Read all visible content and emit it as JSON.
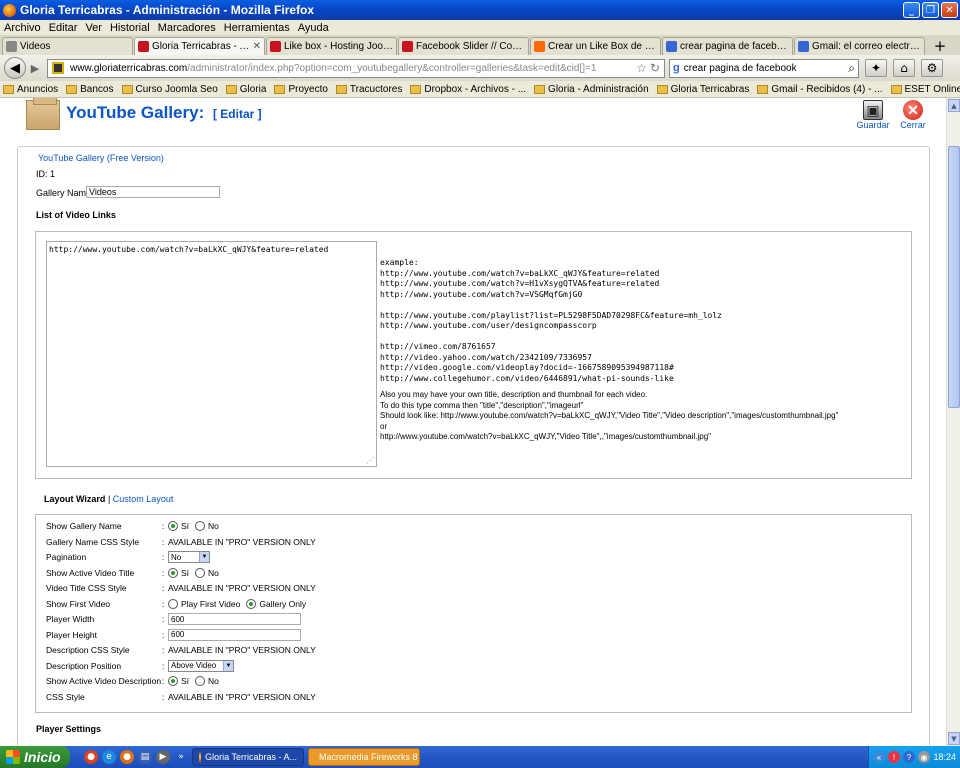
{
  "window": {
    "title": "Gloria Terricabras - Administración - Mozilla Firefox"
  },
  "menu": [
    "Archivo",
    "Editar",
    "Ver",
    "Historial",
    "Marcadores",
    "Herramientas",
    "Ayuda"
  ],
  "tabs": [
    {
      "label": "Videos",
      "icon_color": "#888888"
    },
    {
      "label": "Gloria Terricabras - Admin...",
      "icon_color": "#c8141e",
      "active": true
    },
    {
      "label": "Like box - Hosting Joomla",
      "icon_color": "#c8141e"
    },
    {
      "label": "Facebook Slider // Como c...",
      "icon_color": "#c8141e"
    },
    {
      "label": "Crear un Like Box de Fac...",
      "icon_color": "#ff6a00"
    },
    {
      "label": "crear pagina de facebook...",
      "icon_color": "#3666d6"
    },
    {
      "label": "Gmail: el correo electrónic...",
      "icon_color": "#3666d6"
    }
  ],
  "nav": {
    "url_domain": "www.gloriaterricabras.com",
    "url_path": "/administrator/index.php?option=com_youtubegallery&controller=galleries&task=edit&cid[]=1",
    "search_engine": "g",
    "search_value": "crear pagina de facebook"
  },
  "bookmarks": [
    "Anuncios",
    "Bancos",
    "Curso Joomla Seo",
    "Gloria",
    "Proyecto",
    "Tracuctores",
    "Dropbox - Archivos - ...",
    "Gloria - Administración",
    "Gloria Terricabras",
    "Gmail - Recibidos (4) - ...",
    "ESET Online Scanner |..."
  ],
  "toolbar": {
    "title": "YouTube Gallery:",
    "edit_label": "[ Editar ]",
    "save_label": "Guardar",
    "close_label": "Cerrar"
  },
  "form": {
    "legend": "YouTube Gallery (Free Version)",
    "id_line": "ID: 1",
    "gallery_name_label": "Gallery Name",
    "gallery_name_value": "Videos",
    "list_heading": "List of Video Links",
    "links_value": "http://www.youtube.com/watch?v=baLkXC_qWJY&feature=related",
    "example_lines": [
      "example:",
      "http://www.youtube.com/watch?v=baLkXC_qWJY&feature=related",
      "http://www.youtube.com/watch?v=H1vXsygQTVA&feature=related",
      "http://www.youtube.com/watch?v=VSGMqfGmjG0",
      "",
      "http://www.youtube.com/playlist?list=PL5298F5DAD70298FC&feature=mh_lolz",
      "http://www.youtube.com/user/designcompasscorp",
      "",
      "http://vimeo.com/8761657",
      "http://video.yahoo.com/watch/2342109/7336957",
      "http://video.google.com/videoplay?docid=-1667589095394987118#",
      "http://www.collegehumor.com/video/6446891/what-pi-sounds-like"
    ],
    "help_lines": [
      "Also you may have your own title, description and thumbnail for each video.",
      "To do this type comma then \"title\",\"description\",\"imageurl\"",
      "Should look like: http://www.youtube.com/watch?v=baLkXC_qWJY,\"Video Title\",\"Video description\",\"images/customthumbnail.jpg\"",
      "or",
      "http://www.youtube.com/watch?v=baLkXC_qWJY,\"Video Title\",,\"images/customthumbnail.jpg\""
    ],
    "wizard_tab": "Layout Wizard",
    "custom_tab": "Custom Layout",
    "player_settings_heading": "Player Settings"
  },
  "layout_rows": [
    {
      "label": "Show Gallery Name",
      "type": "radio",
      "options": [
        "Sí",
        "No"
      ],
      "selected": 0
    },
    {
      "label": "Gallery Name CSS Style",
      "type": "text",
      "value": "AVAILABLE IN \"PRO\" VERSION ONLY"
    },
    {
      "label": "Pagination",
      "type": "select",
      "value": "No"
    },
    {
      "label": "Show Active Video Title",
      "type": "radio",
      "options": [
        "Sí",
        "No"
      ],
      "selected": 0
    },
    {
      "label": "Video Title CSS Style",
      "type": "text",
      "value": "AVAILABLE IN \"PRO\" VERSION ONLY"
    },
    {
      "label": "Show First Video",
      "type": "radio",
      "options": [
        "Play First Video",
        "Gallery Only"
      ],
      "selected": 1
    },
    {
      "label": "Player Width",
      "type": "input",
      "value": "600"
    },
    {
      "label": "Player Height",
      "type": "input",
      "value": "600"
    },
    {
      "label": "Description CSS Style",
      "type": "text",
      "value": "AVAILABLE IN \"PRO\" VERSION ONLY"
    },
    {
      "label": "Description Position",
      "type": "select",
      "value": "Above Video"
    },
    {
      "label": "Show Active Video Description",
      "type": "radio",
      "options": [
        "Sí",
        "No"
      ],
      "selected": 0
    },
    {
      "label": "CSS Style",
      "type": "text",
      "value": "AVAILABLE IN \"PRO\" VERSION ONLY"
    }
  ],
  "taskbar": {
    "start_label": "Inicio",
    "tasks": [
      "Gloria Terricabras - A...",
      "Macromedia Fireworks 8"
    ],
    "clock": "18:24"
  },
  "colors": {
    "link": "#0b55c4",
    "xp_blue": "#2457c4",
    "start_green": "#2f8a2f"
  }
}
